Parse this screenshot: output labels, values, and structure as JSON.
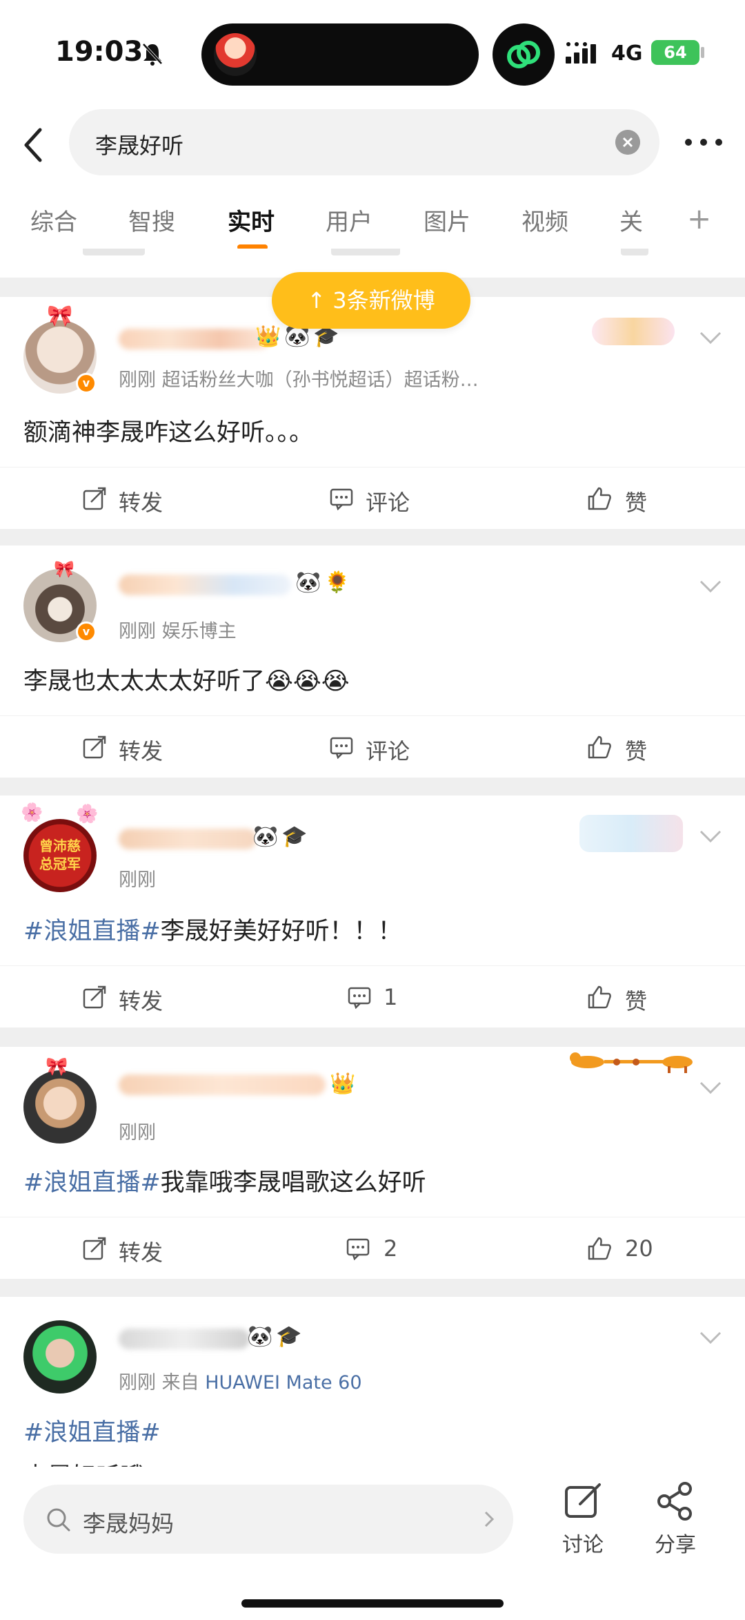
{
  "status_bar": {
    "time": "19:03",
    "network": "4G",
    "battery": "64"
  },
  "search": {
    "query": "李晟好听"
  },
  "tabs": [
    {
      "label": "综合"
    },
    {
      "label": "智搜"
    },
    {
      "label": "实时",
      "active": true
    },
    {
      "label": "用户"
    },
    {
      "label": "图片"
    },
    {
      "label": "视频"
    },
    {
      "label": "关"
    }
  ],
  "new_posts_pill": "↑ 3条新微博",
  "posts": [
    {
      "meta": "刚刚  超话粉丝大咖（孙书悦超话）超话粉…",
      "content": "额滴神李晟咋这么好听。。。",
      "repost": "转发",
      "comment": "评论",
      "like": "赞"
    },
    {
      "meta": "刚刚  娱乐博主",
      "content": "李晟也太太太太好听了",
      "emojis": "😭😭😭",
      "repost": "转发",
      "comment": "评论",
      "like": "赞"
    },
    {
      "meta": "刚刚",
      "topic": "#浪姐直播#",
      "content": "李晟好美好好听！！！",
      "repost": "转发",
      "comment": "1",
      "like": "赞",
      "avatar_text": "曾沛慈总冠军"
    },
    {
      "meta": "刚刚",
      "topic": "#浪姐直播#",
      "content": "我靠哦李晟唱歌这么好听",
      "repost": "转发",
      "comment": "2",
      "like": "20"
    },
    {
      "meta_prefix": "刚刚  来自",
      "meta_device": "HUAWEI Mate 60",
      "topic": "#浪姐直播#",
      "content": "李晟好听哦"
    }
  ],
  "bottom_bar": {
    "search_query": "李晟妈妈",
    "discuss": "讨论",
    "share": "分享"
  },
  "colors": {
    "accent": "#ff8200",
    "pill": "#ffbe1a",
    "topic": "#4a6fa5",
    "verified": "#ff8a00"
  }
}
